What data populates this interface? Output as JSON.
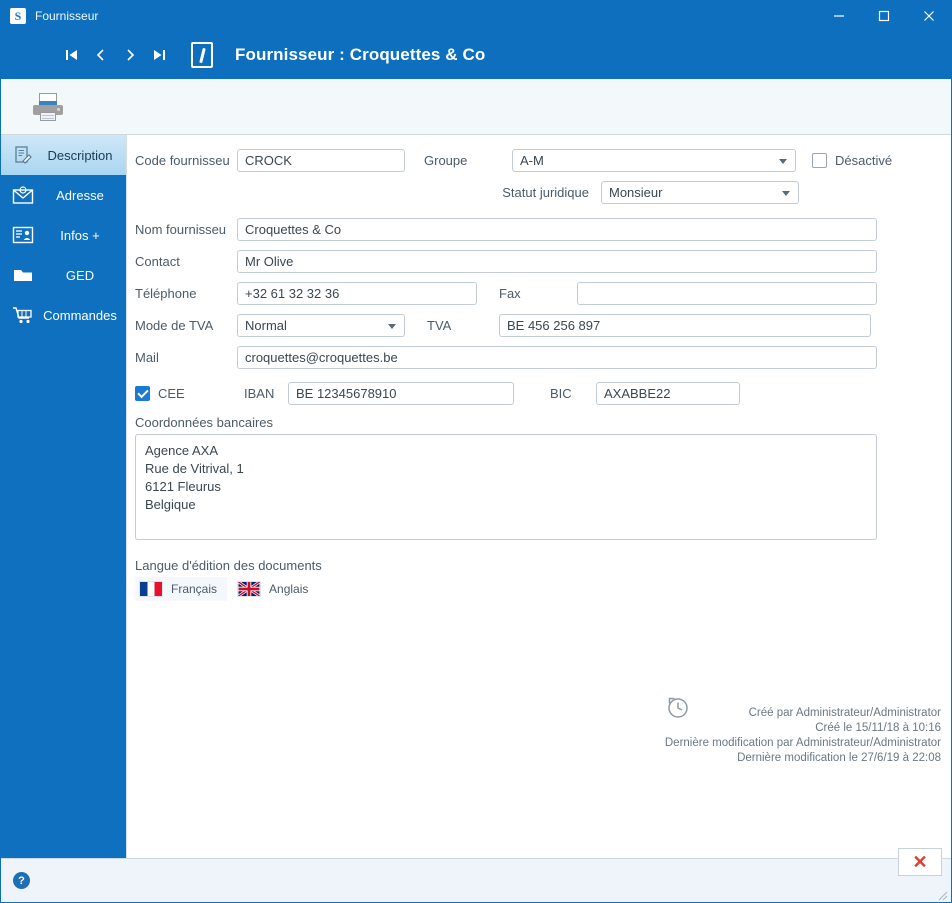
{
  "window": {
    "app_icon": "S",
    "title": "Fournisseur",
    "controls": {
      "minimize": "minimize-icon",
      "maximize": "maximize-icon",
      "close": "close-icon"
    }
  },
  "header": {
    "nav": [
      {
        "name": "first-record",
        "glyph": "first"
      },
      {
        "name": "previous-record",
        "glyph": "prev"
      },
      {
        "name": "next-record",
        "glyph": "next"
      },
      {
        "name": "last-record",
        "glyph": "last"
      }
    ],
    "edit_icon": "edit-document-icon",
    "title": "Fournisseur : Croquettes & Co"
  },
  "toolbar": {
    "print_icon": "printer-icon"
  },
  "sidebar": {
    "items": [
      {
        "label": "Description",
        "icon": "document-edit-icon",
        "active": true
      },
      {
        "label": "Adresse",
        "icon": "envelope-icon",
        "active": false
      },
      {
        "label": "Infos +",
        "icon": "contact-card-icon",
        "active": false
      },
      {
        "label": "GED",
        "icon": "folder-icon",
        "active": false
      },
      {
        "label": "Commandes",
        "icon": "shopping-cart-icon",
        "active": false
      }
    ]
  },
  "form": {
    "code_label": "Code fournisseu",
    "code_value": "CROCK",
    "groupe_label": "Groupe",
    "groupe_value": "A-M",
    "desactive_label": "Désactivé",
    "desactive_checked": false,
    "statut_label": "Statut juridique",
    "statut_value": "Monsieur",
    "nom_label": "Nom fournisseu",
    "nom_value": "Croquettes & Co",
    "contact_label": "Contact",
    "contact_value": "Mr Olive",
    "telephone_label": "Téléphone",
    "telephone_value": "+32 61 32 32 36",
    "fax_label": "Fax",
    "fax_value": "",
    "mode_tva_label": "Mode de TVA",
    "mode_tva_value": "Normal",
    "tva_label": "TVA",
    "tva_value": "BE 456 256 897",
    "mail_label": "Mail",
    "mail_value": "croquettes@croquettes.be",
    "cee_label": "CEE",
    "cee_checked": true,
    "iban_label": "IBAN",
    "iban_value": "BE 12345678910",
    "bic_label": "BIC",
    "bic_value": "AXABBE22",
    "bank_label": "Coordonnées bancaires",
    "bank_value": "Agence AXA\nRue de Vitrival, 1\n6121 Fleurus\nBelgique",
    "langue_label": "Langue d'édition des documents",
    "langues": [
      {
        "label": "Français",
        "icon": "flag-france-icon",
        "selected": true
      },
      {
        "label": "Anglais",
        "icon": "flag-uk-icon",
        "selected": false
      }
    ]
  },
  "meta": {
    "history_icon": "history-clock-icon",
    "lines": [
      "Créé par Administrateur/Administrator",
      "Créé le 15/11/18 à 10:16",
      "Dernière modification par Administrateur/Administrator",
      "Dernière modification le 27/6/19 à 22:08"
    ]
  },
  "bottom": {
    "help_icon": "help-icon",
    "help_label": "?",
    "close_label": "✕"
  }
}
